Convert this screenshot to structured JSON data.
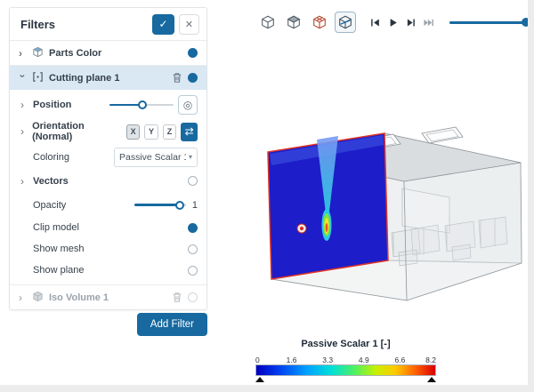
{
  "panel": {
    "title": "Filters",
    "rows": {
      "parts_color": "Parts Color",
      "cutting_plane": "Cutting plane 1",
      "iso_volume": "Iso Volume 1"
    },
    "props": {
      "position": "Position",
      "orientation": "Orientation (Normal)",
      "axes": [
        "X",
        "Y",
        "Z"
      ],
      "coloring": "Coloring",
      "coloring_value": "Passive Scalar 1",
      "vectors": "Vectors",
      "opacity": "Opacity",
      "opacity_value": "1",
      "clip_model": "Clip model",
      "show_mesh": "Show mesh",
      "show_plane": "Show plane"
    },
    "add_filter": "Add Filter"
  },
  "icons": {
    "apply": "✓",
    "close": "✕",
    "chevron": "›",
    "caret": "▾",
    "swap": "⇄",
    "picker": "◎"
  },
  "toolbar": {
    "view_icons": [
      "perspective-cube",
      "shaded-cube",
      "mesh-cube",
      "cutting-plane-view"
    ],
    "playback_icons": [
      "skip-to-start",
      "play",
      "step-forward",
      "skip-to-end"
    ]
  },
  "legend": {
    "title": "Passive Scalar 1 [-]",
    "ticks": [
      "0",
      "1.6",
      "3.3",
      "4.9",
      "6.6",
      "8.2"
    ],
    "range": [
      0,
      8.2
    ],
    "colors": [
      "#0000c0",
      "#0040f0",
      "#00a0ff",
      "#00e0d8",
      "#50f060",
      "#c8f000",
      "#ffc800",
      "#ff6000",
      "#d80000"
    ]
  },
  "viewport": {
    "plane_color": "#1d1dc9",
    "plane_edge_color": "#e03226",
    "accent_color": "#1769a0"
  }
}
